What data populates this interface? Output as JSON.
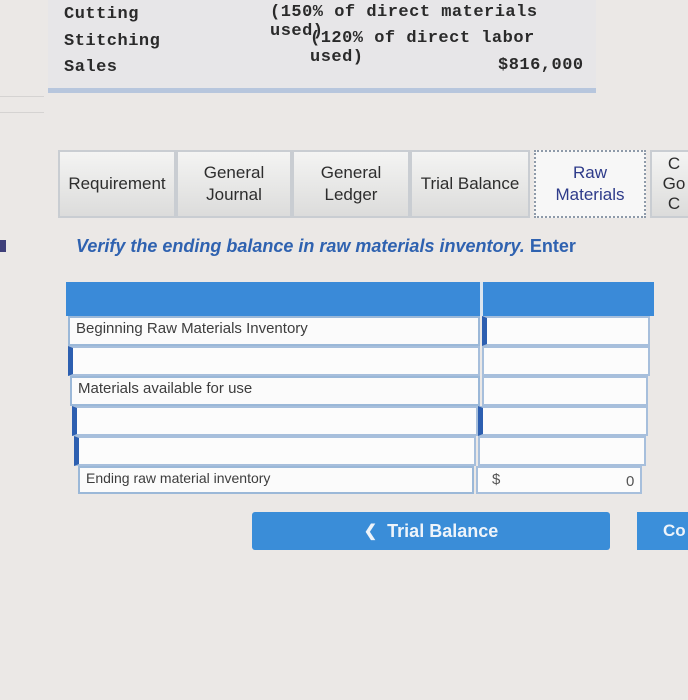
{
  "info": {
    "rows": [
      {
        "label": "Cutting",
        "value": "(150% of direct materials used)"
      },
      {
        "label": "Stitching",
        "value": "(120% of direct labor used)"
      },
      {
        "label": "Sales",
        "value": "$816,000"
      }
    ]
  },
  "tabs": [
    {
      "label": "Requirement",
      "line2": ""
    },
    {
      "label": "General",
      "line2": "Journal"
    },
    {
      "label": "General",
      "line2": "Ledger"
    },
    {
      "label": "Trial Balance",
      "line2": ""
    },
    {
      "label": "Raw",
      "line2": "Materials"
    },
    {
      "label": "C",
      "line2": "Go",
      "line3": "C"
    }
  ],
  "instruction": {
    "text": "Verify the ending balance in raw materials inventory.",
    "enter": "Enter"
  },
  "table": {
    "rows": [
      {
        "label": "Beginning Raw Materials Inventory",
        "value": ""
      },
      {
        "label": "",
        "value": ""
      },
      {
        "label": "Materials available for use",
        "value": ""
      },
      {
        "label": "",
        "value": ""
      },
      {
        "label": "",
        "value": ""
      },
      {
        "label": "Ending raw material inventory",
        "currency": "$",
        "value": "0"
      }
    ]
  },
  "nav": {
    "prev_label": "Trial Balance",
    "next_label": "Co"
  },
  "colors": {
    "accent": "#3a8ad8",
    "instruction": "#2f62b0"
  }
}
